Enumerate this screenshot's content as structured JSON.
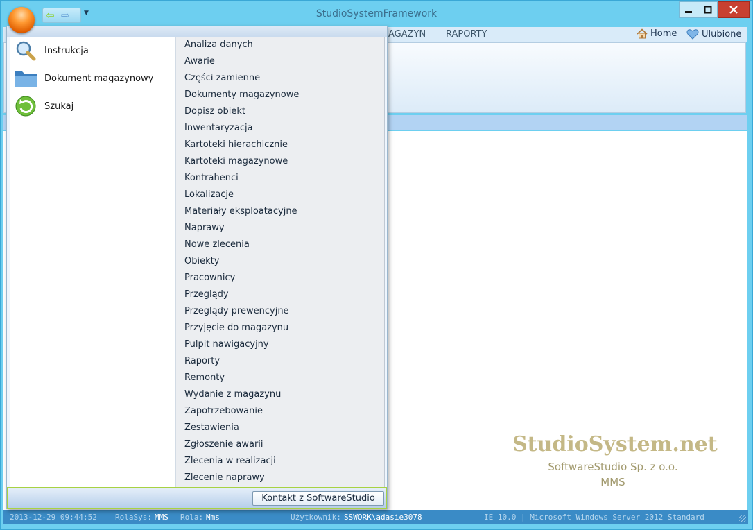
{
  "window": {
    "title": "StudioSystemFramework",
    "colors": {
      "frame": "#6dcff0",
      "statusbar": "#3a8bc6",
      "close": "#c84031",
      "menu_footer_border": "#a8d243"
    }
  },
  "ribbon": {
    "tabs": [
      "AGAZYN",
      "RAPORTY"
    ],
    "home_label": "Home",
    "favorites_label": "Ulubione"
  },
  "app_menu": {
    "left_items": [
      {
        "label": "Instrukcja",
        "icon": "magnifier-icon"
      },
      {
        "label": "Dokument magazynowy",
        "icon": "folder-icon"
      },
      {
        "label": "Szukaj",
        "icon": "refresh-arrow-icon"
      }
    ],
    "right_items": [
      "Analiza danych",
      "Awarie",
      "Części zamienne",
      "Dokumenty magazynowe",
      "Dopisz obiekt",
      "Inwentaryzacja",
      "Kartoteki hierachicznie",
      "Kartoteki magazynowe",
      "Kontrahenci",
      "Lokalizacje",
      "Materiały eksploatacyjne",
      "Naprawy",
      "Nowe zlecenia",
      "Obiekty",
      "Pracownicy",
      "Przeglądy",
      "Przeglądy prewencyjne",
      "Przyjęcie do magazynu",
      "Pulpit nawigacyjny",
      "Raporty",
      "Remonty",
      "Wydanie z magazynu",
      "Zapotrzebowanie",
      "Zestawienia",
      "Zgłoszenie awarii",
      "Zlecenia w realizacji",
      "Zlecenie naprawy"
    ],
    "contact_button": "Kontakt z SoftwareStudio"
  },
  "branding": {
    "title": "StudioSystem.net",
    "company": "SoftwareStudio Sp. z o.o.",
    "product": "MMS"
  },
  "statusbar": {
    "datetime": "2013-12-29 09:44:52",
    "rolasys_label": "RolaSys:",
    "rolasys_value": "MMS",
    "rola_label": "Rola:",
    "rola_value": "Mms",
    "user_label": "Użytkownik:",
    "user_value": "SSWORK\\adasie3078",
    "env": "IE 10.0 | Microsoft Windows Server 2012 Standard"
  }
}
